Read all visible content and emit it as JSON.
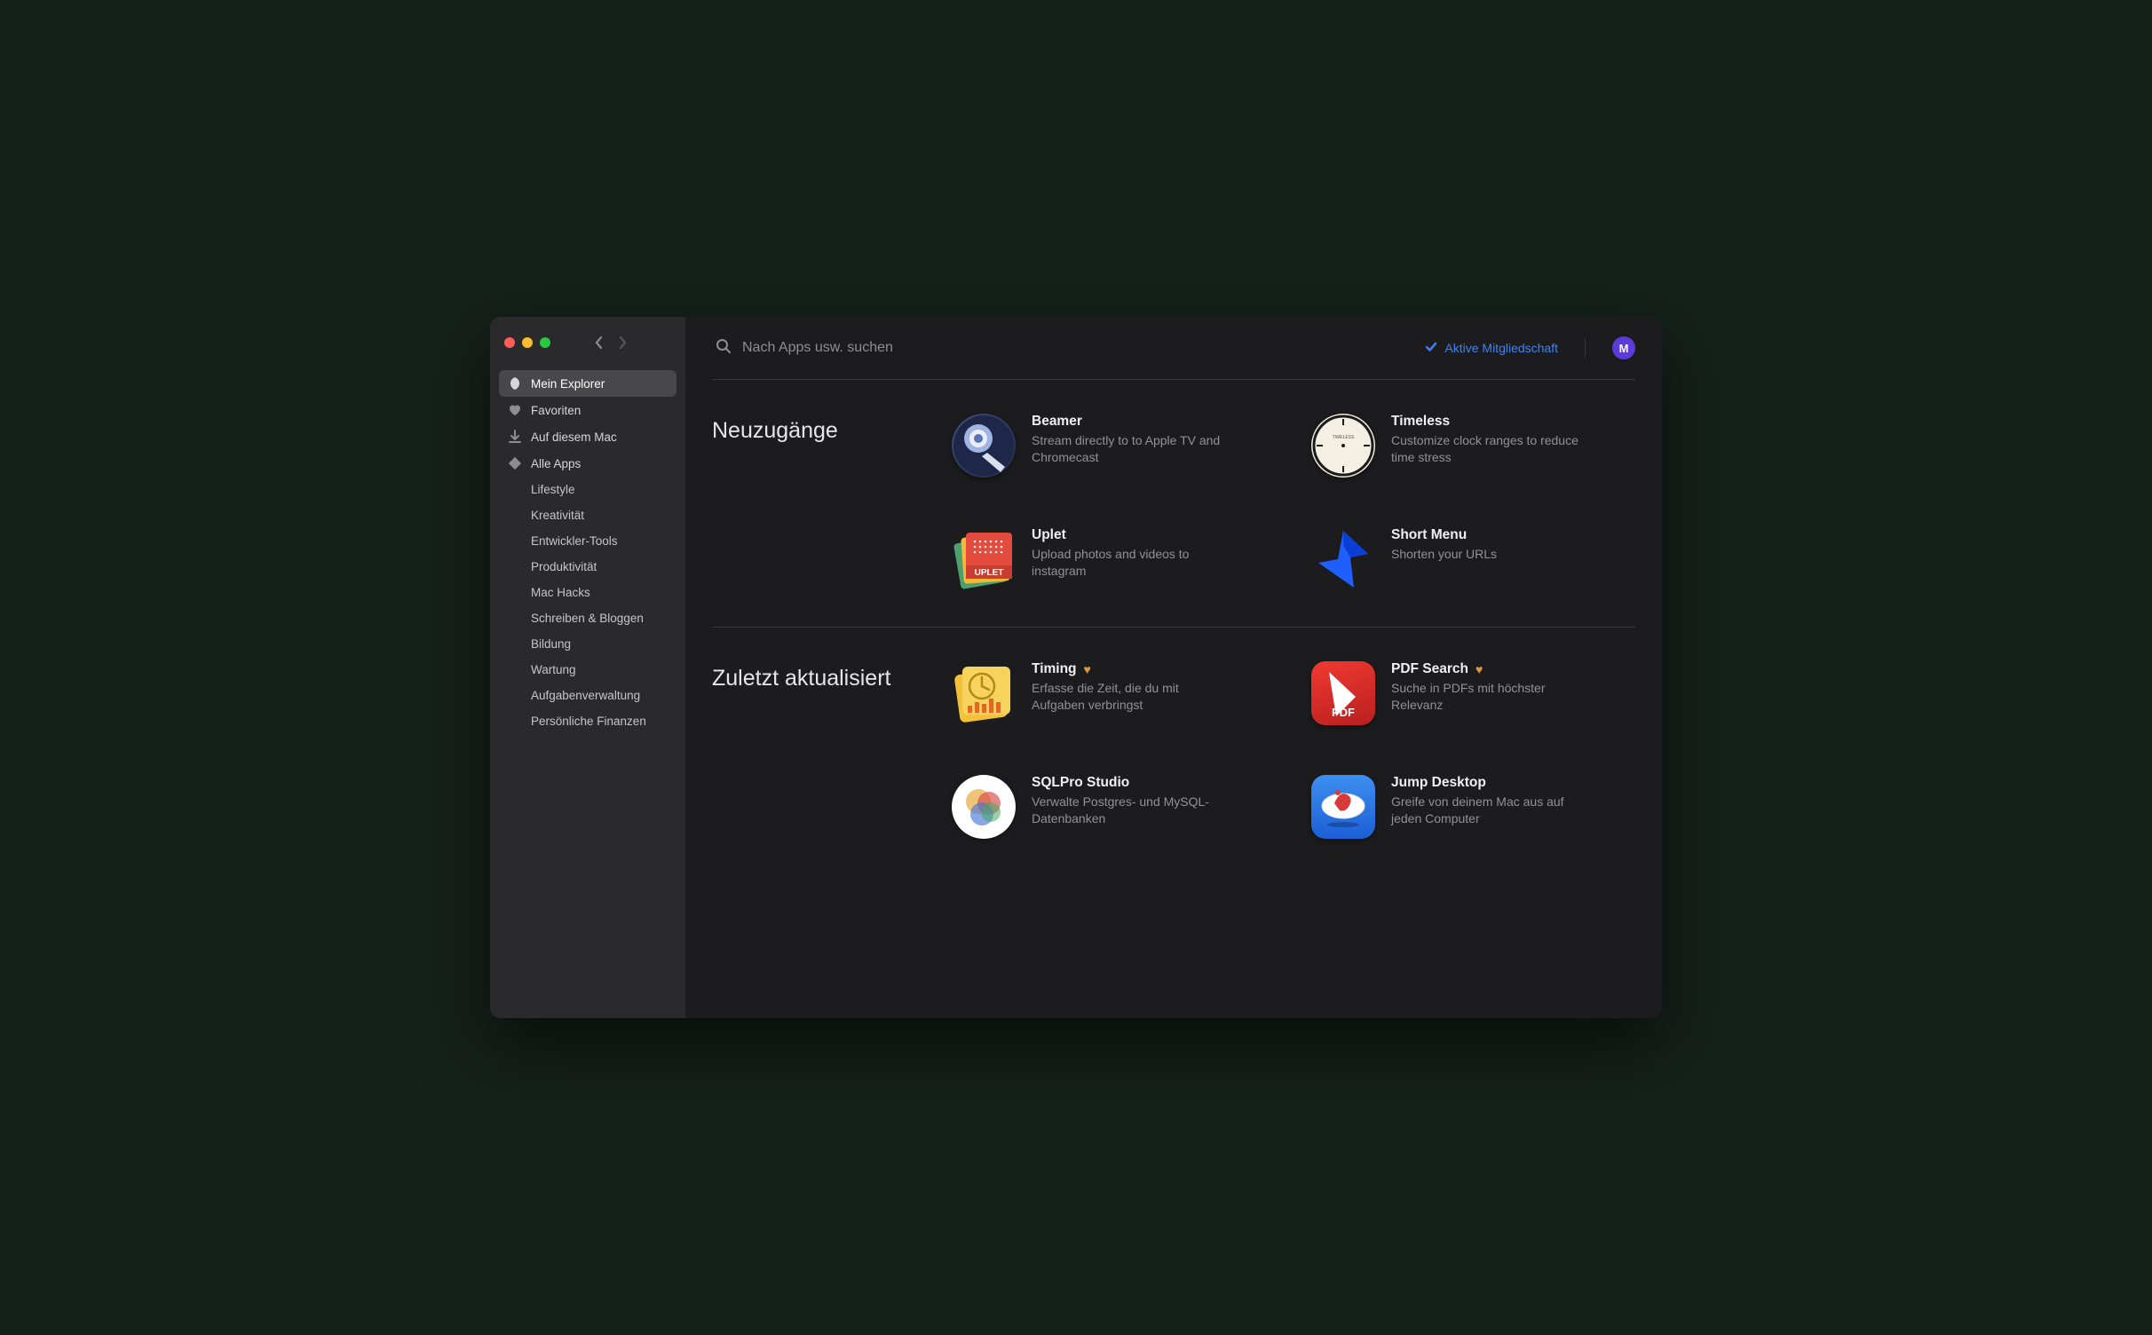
{
  "search": {
    "placeholder": "Nach Apps usw. suchen"
  },
  "membership": {
    "label": "Aktive Mitgliedschaft"
  },
  "avatar": {
    "initial": "M"
  },
  "sidebar": {
    "items": [
      {
        "icon": "explorer-icon",
        "label": "Mein Explorer",
        "active": true
      },
      {
        "icon": "heart-icon",
        "label": "Favoriten"
      },
      {
        "icon": "download-icon",
        "label": "Auf diesem Mac"
      },
      {
        "icon": "diamond-icon",
        "label": "Alle Apps",
        "children": [
          "Lifestyle",
          "Kreativität",
          "Entwickler-Tools",
          "Produktivität",
          "Mac Hacks",
          "Schreiben & Bloggen",
          "Bildung",
          "Wartung",
          "Aufgabenverwaltung",
          "Persönliche Finanzen"
        ]
      }
    ]
  },
  "sections": [
    {
      "title": "Neuzugänge",
      "apps": [
        {
          "name": "Beamer",
          "desc": "Stream directly to to Apple TV and Chromecast",
          "icon": "beamer"
        },
        {
          "name": "Timeless",
          "desc": "Customize clock ranges to reduce time stress",
          "icon": "timeless"
        },
        {
          "name": "Uplet",
          "desc": "Upload photos and videos to instagram",
          "icon": "uplet"
        },
        {
          "name": "Short Menu",
          "desc": "Shorten your URLs",
          "icon": "shortmenu"
        }
      ]
    },
    {
      "title": "Zuletzt aktualisiert",
      "apps": [
        {
          "name": "Timing",
          "desc": "Erfasse die Zeit, die du mit Aufgaben verbringst",
          "icon": "timing",
          "fav": true
        },
        {
          "name": "PDF Search",
          "desc": "Suche in PDFs mit höchster Relevanz",
          "icon": "pdfsearch",
          "fav": true
        },
        {
          "name": "SQLPro Studio",
          "desc": "Verwalte Postgres- und MySQL-Datenbanken",
          "icon": "sqlpro"
        },
        {
          "name": "Jump Desktop",
          "desc": "Greife von deinem Mac aus auf jeden Computer",
          "icon": "jumpdesktop"
        }
      ]
    }
  ]
}
